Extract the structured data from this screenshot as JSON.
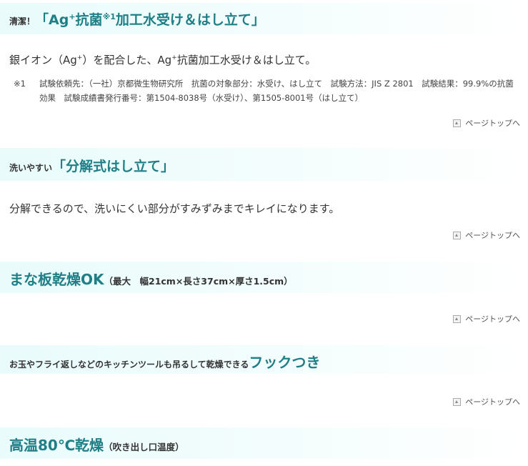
{
  "sections": [
    {
      "lead": "清潔！",
      "title_parts": [
        "「Ag",
        "+",
        "抗菌",
        "※1",
        "加工水受け＆はし立て」"
      ]
    },
    {
      "lead": "洗いやすい",
      "title": "「分解式はし立て」"
    },
    {
      "title": "まな板乾燥OK",
      "note": "（最大　幅21cm×長さ37cm×厚さ1.5cm）"
    },
    {
      "lead": "お玉やフライ返しなどのキッチンツールも吊るして乾燥できる",
      "title": "フックつき"
    },
    {
      "title": "高温80℃乾燥",
      "note": "（吹き出し口温度）"
    }
  ],
  "desc1_parts": [
    "銀イオン（Ag",
    "+",
    "）を配合した、Ag",
    "+",
    "抗菌加工水受け＆はし立て。"
  ],
  "footnote": {
    "mark": "※1",
    "text": "試験依頼先：（一社）京都微生物研究所　抗菌の対象部分：水受け、はし立て　試験方法：JIS Z 2801　試験結果：99.9%の抗菌効果　試験成績書発行番号：第1504-8038号（水受け）、第1505-8001号（はし立て）"
  },
  "desc2": "分解できるので、洗いにくい部分がすみずみまでキレイになります。",
  "page_top_label": "ページトップへ",
  "colors": {
    "title_teal": "#1f7f86",
    "band": "#e9fbfb"
  },
  "icons": {
    "page_top": "page-top-arrow-icon"
  }
}
